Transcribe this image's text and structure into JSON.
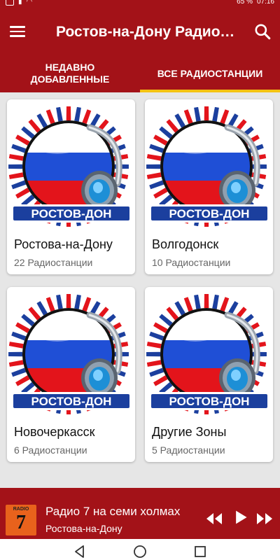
{
  "status_bar": {
    "battery": "65 %",
    "time": "07:16"
  },
  "app_bar": {
    "title": "Ростов-на-Дону Радиостанции",
    "menu_icon": "hamburger-menu-icon",
    "search_icon": "search-icon"
  },
  "tabs": [
    {
      "label": "НЕДАВНО ДОБАВЛЕННЫЕ",
      "active": false
    },
    {
      "label": "ВСЕ РАДИОСТАНЦИИ",
      "active": true
    }
  ],
  "cards": [
    {
      "title": "Ростова-на-Дону",
      "subtitle": "22 Радиостанции",
      "image_label": "РОСТОВ-ДОН"
    },
    {
      "title": "Волгодонск",
      "subtitle": "10 Радиостанции",
      "image_label": "РОСТОВ-ДОН"
    },
    {
      "title": "Новочеркасск",
      "subtitle": "6 Радиостанции",
      "image_label": "РОСТОВ-ДОН"
    },
    {
      "title": "Другие Зоны",
      "subtitle": "5 Радиостанции",
      "image_label": "РОСТОВ-ДОН"
    }
  ],
  "player": {
    "title": "Радио 7 на семи холмах",
    "subtitle": "Ростова-на-Дону",
    "logo_text": "RADIO",
    "logo_number": "7"
  },
  "colors": {
    "primary": "#a31218",
    "tab_indicator": "#f4c312",
    "flag_white": "#ffffff",
    "flag_blue": "#1f4fd6",
    "flag_red": "#e3141b",
    "badge_blue": "#1b3f9e"
  }
}
